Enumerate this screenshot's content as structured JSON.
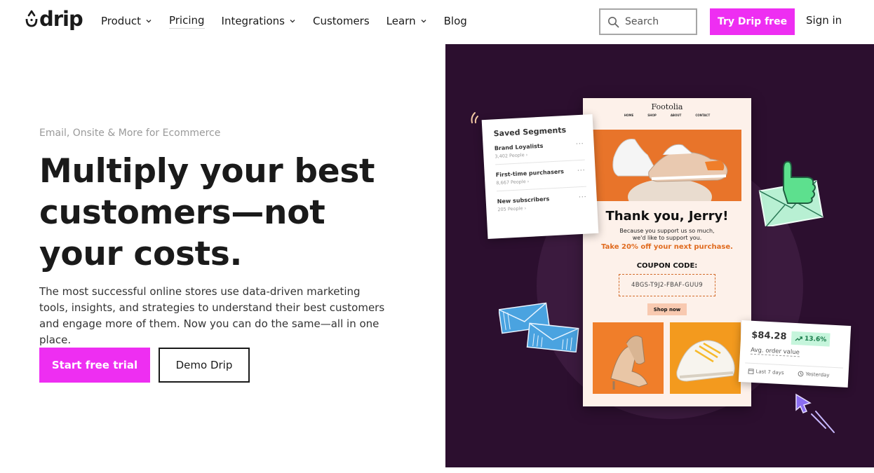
{
  "nav": {
    "logo": "drip",
    "items": [
      {
        "label": "Product",
        "has_dropdown": true
      },
      {
        "label": "Pricing",
        "has_dropdown": false
      },
      {
        "label": "Integrations",
        "has_dropdown": true
      },
      {
        "label": "Customers",
        "has_dropdown": false
      },
      {
        "label": "Learn",
        "has_dropdown": true
      },
      {
        "label": "Blog",
        "has_dropdown": false
      }
    ],
    "search_placeholder": "Search",
    "cta": "Try Drip free",
    "signin": "Sign in"
  },
  "hero": {
    "eyebrow": "Email, Onsite & More for Ecommerce",
    "headline": "Multiply your best customers—not your costs.",
    "subtext": "The most successful online stores use data-driven marketing tools, insights, and strategies to understand their best customers and engage more of them. Now you can do the same—all in one place.",
    "primary_button": "Start free trial",
    "secondary_button": "Demo Drip"
  },
  "illustration": {
    "email": {
      "brand": "Footolia",
      "menu": [
        "HOME",
        "SHOP",
        "ABOUT",
        "CONTACT"
      ],
      "title": "Thank you, Jerry!",
      "body_line1": "Because you support us so much,",
      "body_line2": "we'd like to support you.",
      "offer": "Take 20% off your next purchase.",
      "coupon_label": "COUPON CODE:",
      "coupon_code": "4BGS-T9J2-FBAF-GUU9",
      "shop_button": "Shop now"
    },
    "segments": {
      "title": "Saved Segments",
      "items": [
        {
          "name": "Brand Loyalists",
          "count": "3,402 People ›"
        },
        {
          "name": "First-time purchasers",
          "count": "8,667 People ›"
        },
        {
          "name": "New subscribers",
          "count": "205 People ›"
        }
      ]
    },
    "metric": {
      "value": "$84.28",
      "change": "13.6%",
      "label": "Avg. order value",
      "period": "Last 7 days",
      "compare": "Yesterday"
    }
  },
  "colors": {
    "accent": "#ee2ef2",
    "panel": "#2c0f2f",
    "offer": "#e06b1f",
    "positive": "#167a48"
  }
}
